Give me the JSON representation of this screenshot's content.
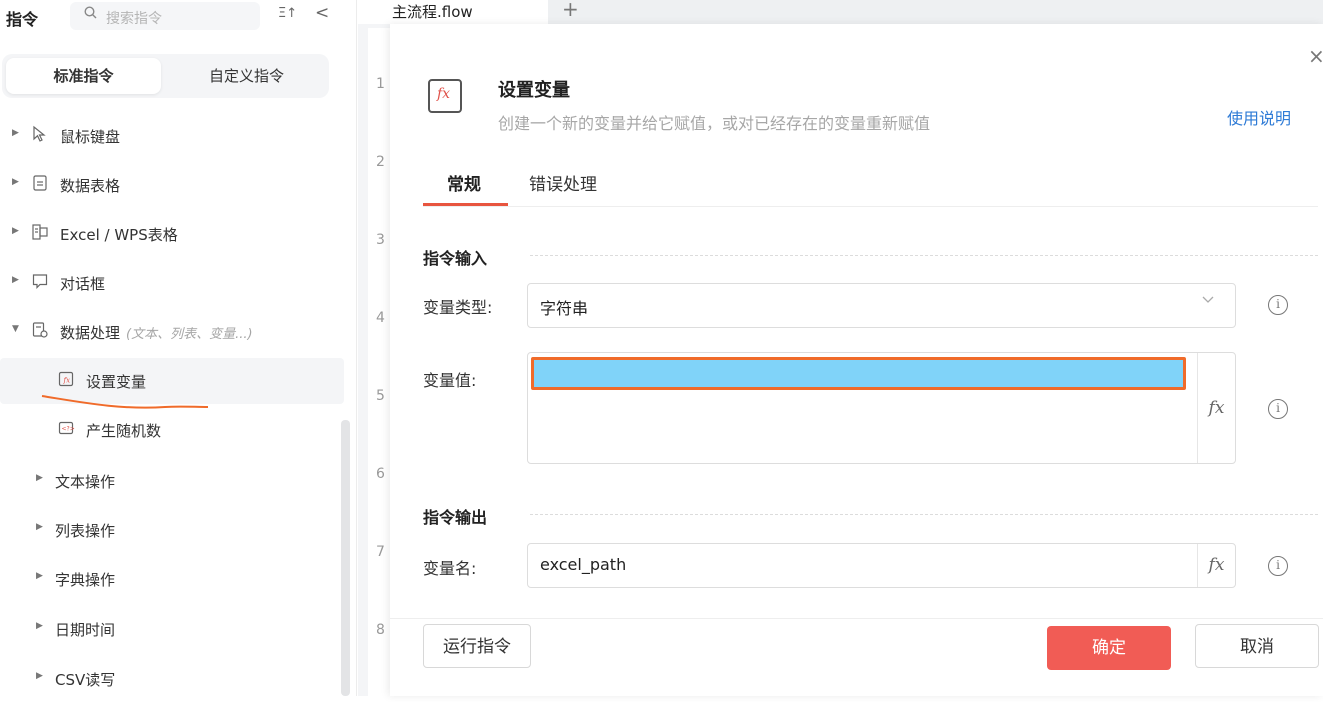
{
  "sidebar": {
    "title": "指令",
    "search_placeholder": "搜索指令",
    "sort_glyph": "Ξ↑",
    "collapse_glyph": "<",
    "segments": {
      "standard": "标准指令",
      "custom": "自定义指令"
    },
    "items": [
      {
        "label": "鼠标键盘",
        "icon": "cursor-icon"
      },
      {
        "label": "数据表格",
        "icon": "document-icon"
      },
      {
        "label": "Excel / WPS表格",
        "icon": "excel-icon"
      },
      {
        "label": "对话框",
        "icon": "dialog-icon"
      },
      {
        "label": "数据处理",
        "hint": "(文本、列表、变量...)",
        "icon": "data-process-icon"
      },
      {
        "label": "设置变量",
        "icon": "set-variable-icon"
      },
      {
        "label": "产生随机数",
        "icon": "random-icon"
      },
      {
        "label": "文本操作"
      },
      {
        "label": "列表操作"
      },
      {
        "label": "字典操作"
      },
      {
        "label": "日期时间"
      },
      {
        "label": "CSV读写"
      }
    ]
  },
  "editor": {
    "tab_name": "主流程.flow",
    "add_tab": "+",
    "line_numbers": [
      "1",
      "2",
      "3",
      "4",
      "5",
      "6",
      "7",
      "8"
    ]
  },
  "dialog": {
    "close": "×",
    "icon_text": "fx",
    "title": "设置变量",
    "description": "创建一个新的变量并给它赋值，或对已经存在的变量重新赋值",
    "help_link": "使用说明",
    "tabs": {
      "general": "常规",
      "error": "错误处理"
    },
    "input_section": "指令输入",
    "var_type_label": "变量类型:",
    "var_type_value": "字符串",
    "var_value_label": "变量值:",
    "var_value": "",
    "output_section": "指令输出",
    "var_name_label": "变量名:",
    "var_name_value": "excel_path",
    "fx_glyph": "fx",
    "info_glyph": "i",
    "run_button": "运行指令",
    "ok_button": "确定",
    "cancel_button": "取消"
  }
}
